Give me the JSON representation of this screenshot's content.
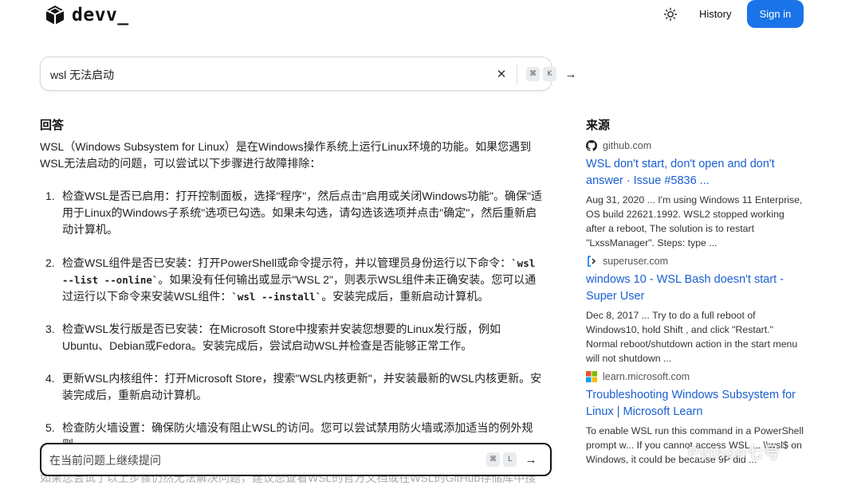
{
  "header": {
    "logo_text": "devv_",
    "theme_icon": "sun-icon",
    "history_label": "History",
    "signin_label": "Sign in"
  },
  "search": {
    "value": "wsl 无法启动",
    "clear_icon": "close-icon",
    "shortcut_keys": [
      "⌘",
      "K"
    ],
    "submit_icon": "arrow-right-icon"
  },
  "answer": {
    "heading": "回答",
    "intro": "WSL（Windows Subsystem for Linux）是在Windows操作系统上运行Linux环境的功能。如果您遇到WSL无法启动的问题，可以尝试以下步骤进行故障排除：",
    "steps": [
      {
        "num": "1.",
        "parts": [
          "检查WSL是否已启用：打开控制面板，选择\"程序\"，然后点击\"启用或关闭Windows功能\"。确保\"适用于Linux的Windows子系统\"选项已勾选。如果未勾选，请勾选该选项并点击\"确定\"，然后重新启动计算机。"
        ]
      },
      {
        "num": "2.",
        "part_a": "检查WSL组件是否已安装：打开PowerShell或命令提示符，并以管理员身份运行以下命令：",
        "code_a": "`wsl --list --online`",
        "part_b": "。如果没有任何输出或显示\"WSL 2\"，则表示WSL组件未正确安装。您可以通过运行以下命令来安装WSL组件：",
        "code_b": "`wsl --install`",
        "part_c": "。安装完成后，重新启动计算机。"
      },
      {
        "num": "3.",
        "parts": [
          "检查WSL发行版是否已安装：在Microsoft Store中搜索并安装您想要的Linux发行版，例如Ubuntu、Debian或Fedora。安装完成后，尝试启动WSL并检查是否能够正常工作。"
        ]
      },
      {
        "num": "4.",
        "parts": [
          "更新WSL内核组件：打开Microsoft Store，搜索\"WSL内核更新\"，并安装最新的WSL内核更新。安装完成后，重新启动计算机。"
        ]
      },
      {
        "num": "5.",
        "parts": [
          "检查防火墙设置：确保防火墙没有阻止WSL的访问。您可以尝试禁用防火墙或添加适当的例外规则。"
        ]
      }
    ],
    "overflow": "如果您尝试了以上步骤仍然无法解决问题，建议您查看WSL的官方文档或在WSL的GitHub存储库中搜"
  },
  "followup": {
    "placeholder": "在当前问题上继续提问",
    "shortcut_keys": [
      "⌘",
      "L"
    ],
    "submit_icon": "arrow-right-icon"
  },
  "sources": {
    "heading": "来源",
    "items": [
      {
        "domain": "github.com",
        "icon": "github-icon",
        "title": "WSL don't start, don't open and don't answer · Issue #5836 ...",
        "snippet": "Aug 31, 2020 ... I'm using Windows 11 Enterprise, OS build 22621.1992. WSL2 stopped working after a reboot, The solution is to restart \"LxssManager\". Steps: type ..."
      },
      {
        "domain": "superuser.com",
        "icon": "superuser-icon",
        "title": "windows 10 - WSL Bash doesn't start - Super User",
        "snippet": "Dec 8, 2017 ... Try to do a full reboot of Windows10, hold Shift , and click \"Restart.\" Normal reboot/shutdown action in the start menu will not shutdown ..."
      },
      {
        "domain": "learn.microsoft.com",
        "icon": "microsoft-icon",
        "title": "Troubleshooting Windows Subsystem for Linux | Microsoft Learn",
        "snippet": "To enable WSL run this command in a PowerShell prompt w... If you cannot access WSL ... \\\\wsl$ on Windows, it could be because 9P did ..."
      }
    ]
  },
  "watermark": "Python七号",
  "colors": {
    "accent": "#1a73e8",
    "link": "#1a5fd1"
  }
}
